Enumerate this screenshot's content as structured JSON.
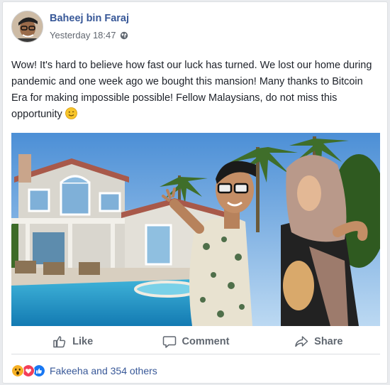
{
  "post": {
    "author": "Baheej bin Faraj",
    "timestamp": "Yesterday 18:47",
    "privacy_icon": "globe-icon",
    "text": "Wow! It's hard to believe how fast our luck has turned. We lost our home during pandemic and one week ago we bought this mansion! Many thanks to Bitcoin Era for making impossible possible! Fellow Malaysians, do not miss this opportunity",
    "text_emoji": "smile-emoji-icon"
  },
  "actions": {
    "like_label": "Like",
    "comment_label": "Comment",
    "share_label": "Share"
  },
  "reactions": {
    "icons": [
      "wow-reaction-icon",
      "love-reaction-icon",
      "like-reaction-icon"
    ],
    "summary": "Fakeeha and 354 others"
  },
  "colors": {
    "link_blue": "#385898",
    "muted_gray": "#606770",
    "like_blue": "#1877f2",
    "love_red": "#f33e58",
    "wow_yellow": "#f7b125"
  }
}
